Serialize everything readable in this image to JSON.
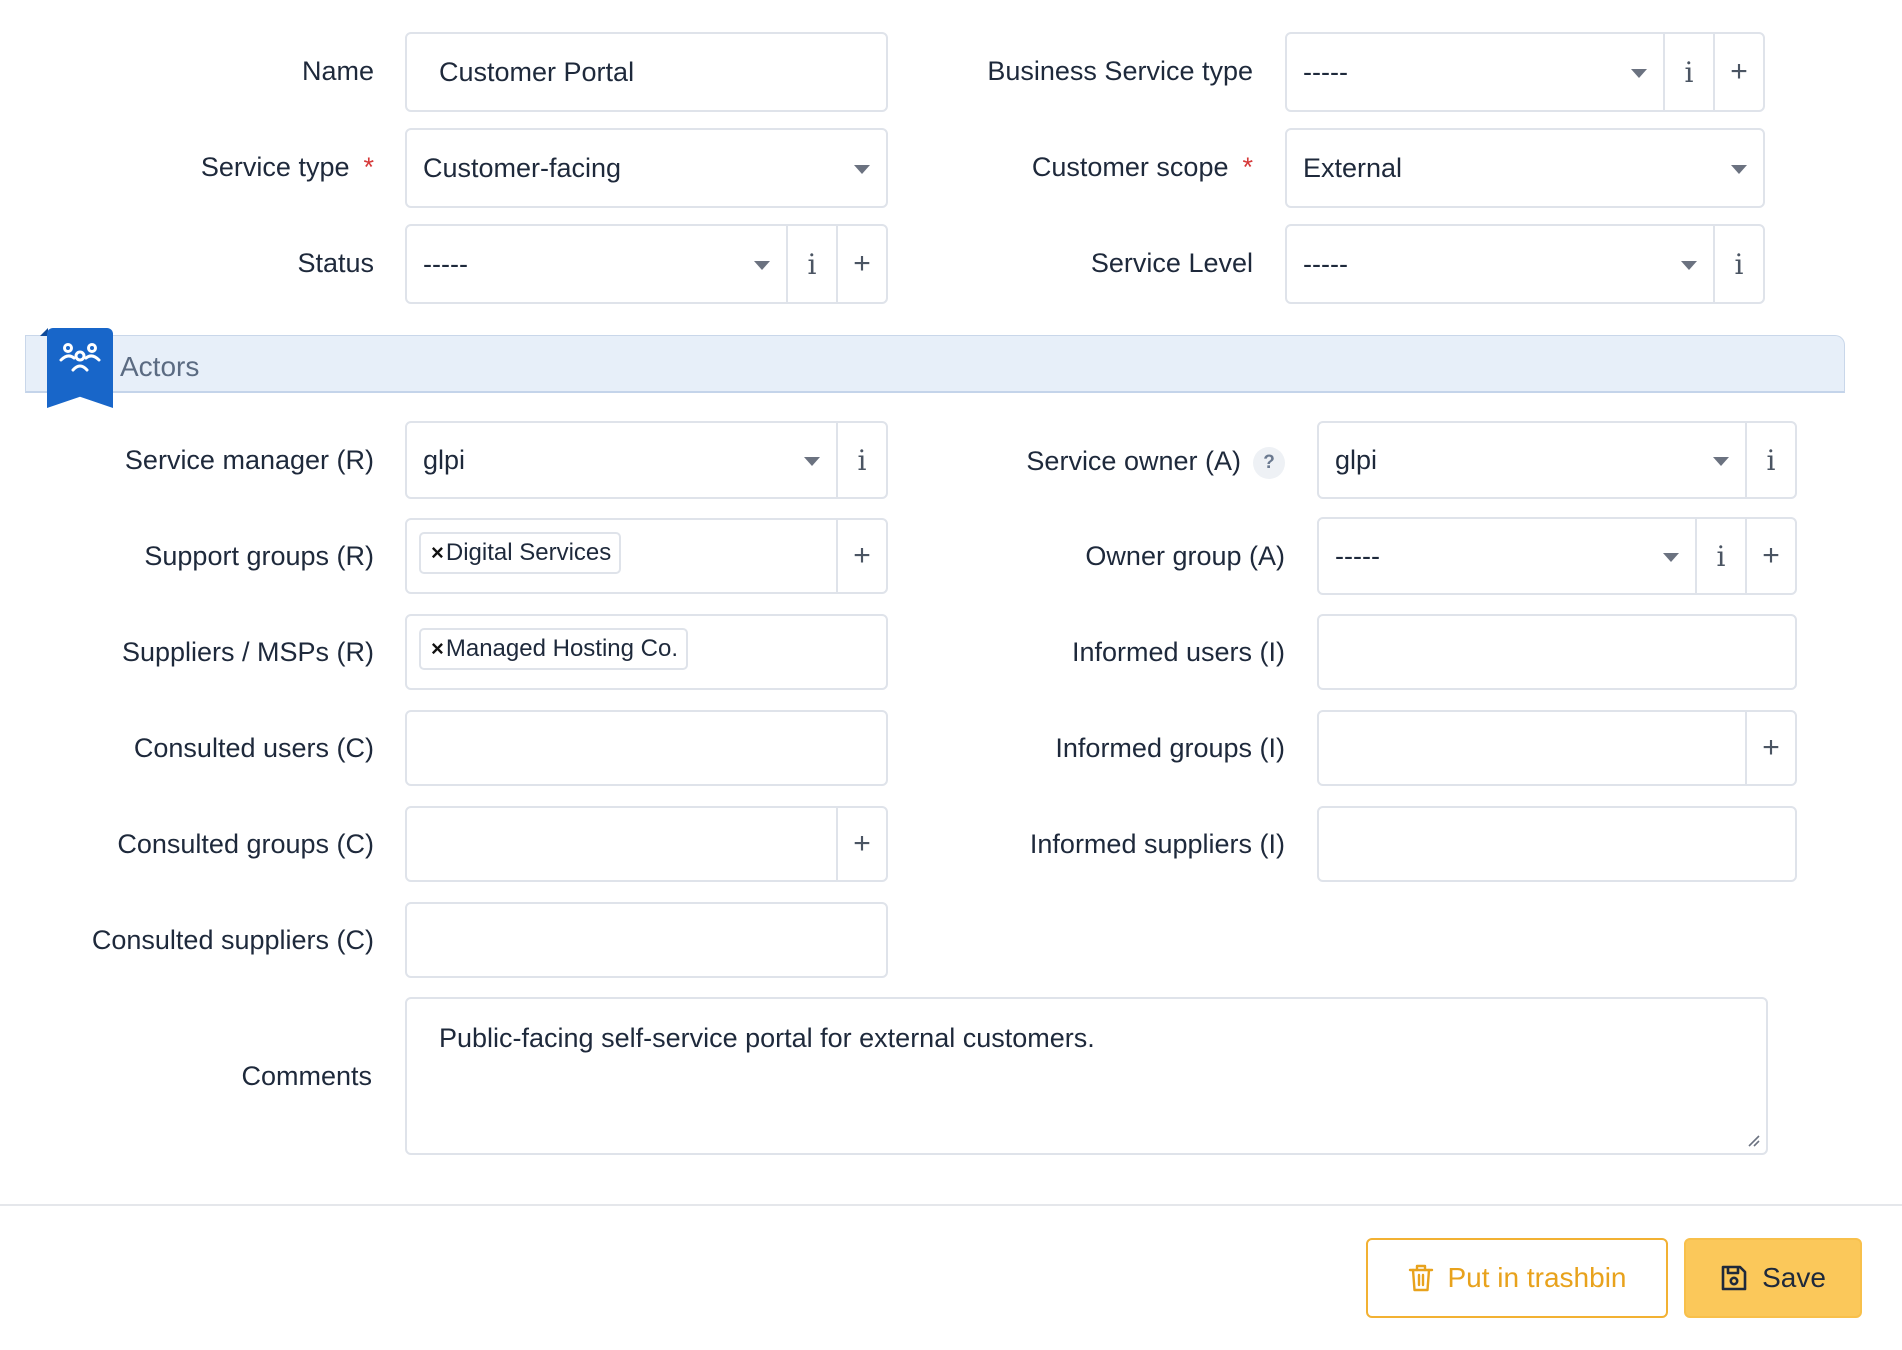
{
  "form": {
    "name": {
      "label": "Name",
      "value": "Customer Portal"
    },
    "business_service_type": {
      "label": "Business Service type",
      "value": "-----"
    },
    "service_type": {
      "label": "Service type",
      "required_mark": "*",
      "value": "Customer-facing"
    },
    "customer_scope": {
      "label": "Customer scope",
      "required_mark": "*",
      "value": "External"
    },
    "status": {
      "label": "Status",
      "value": "-----"
    },
    "service_level": {
      "label": "Service Level",
      "value": "-----"
    }
  },
  "actors_section": {
    "title": "Actors",
    "icon": "users-icon",
    "service_manager": {
      "label": "Service manager (R)",
      "value": "glpi"
    },
    "service_owner": {
      "label": "Service owner (A)",
      "help": "?",
      "value": "glpi"
    },
    "support_groups": {
      "label": "Support groups (R)",
      "chips": [
        "Digital Services"
      ]
    },
    "owner_group": {
      "label": "Owner group (A)",
      "value": "-----"
    },
    "suppliers": {
      "label": "Suppliers / MSPs (R)",
      "chips": [
        "Managed Hosting Co."
      ]
    },
    "informed_users": {
      "label": "Informed users (I)",
      "value": ""
    },
    "consulted_users": {
      "label": "Consulted users (C)",
      "value": ""
    },
    "informed_groups": {
      "label": "Informed groups (I)",
      "value": ""
    },
    "consulted_groups": {
      "label": "Consulted groups (C)",
      "value": ""
    },
    "informed_suppliers": {
      "label": "Informed suppliers (I)",
      "value": ""
    },
    "consulted_suppliers": {
      "label": "Consulted suppliers (C)",
      "value": ""
    }
  },
  "comments": {
    "label": "Comments",
    "value": "Public-facing self-service portal for external customers."
  },
  "chip_remove_symbol": "×",
  "addon_symbols": {
    "info": "i",
    "add": "+"
  },
  "actions": {
    "trash_label": "Put in trashbin",
    "save_label": "Save"
  },
  "colors": {
    "accent": "#1866c9",
    "warning": "#f2b133",
    "save_bg": "#fbc85a",
    "required": "#d63939"
  }
}
